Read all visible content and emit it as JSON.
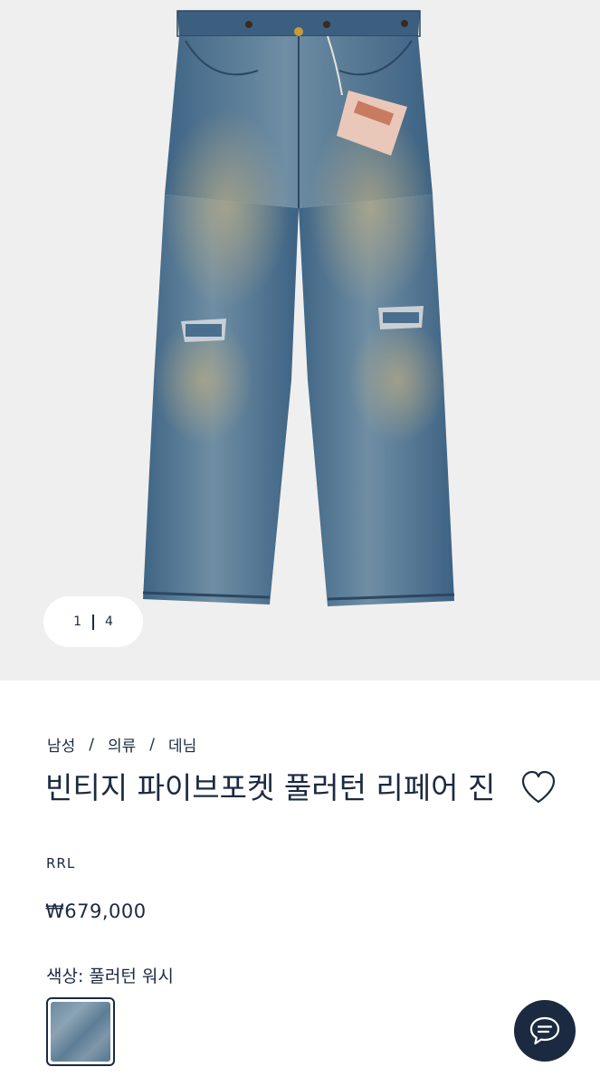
{
  "gallery": {
    "current": "1",
    "total": "4",
    "image_alt": "denim-jeans-product-photo"
  },
  "breadcrumb": {
    "items": [
      "남성",
      "의류",
      "데님"
    ],
    "separator": "/"
  },
  "product": {
    "title": "빈티지 파이브포켓 풀러턴 리페어 진",
    "brand": "RRL",
    "price": "₩679,000"
  },
  "color": {
    "label": "색상: 풀러턴 워시",
    "swatch_name": "풀러턴 워시"
  },
  "icons": {
    "wishlist": "heart-outline-icon",
    "chat": "chat-bubble-icon"
  },
  "colors": {
    "primary": "#1b2a40",
    "hero_bg": "#efefef",
    "denim": "#4f7394"
  }
}
